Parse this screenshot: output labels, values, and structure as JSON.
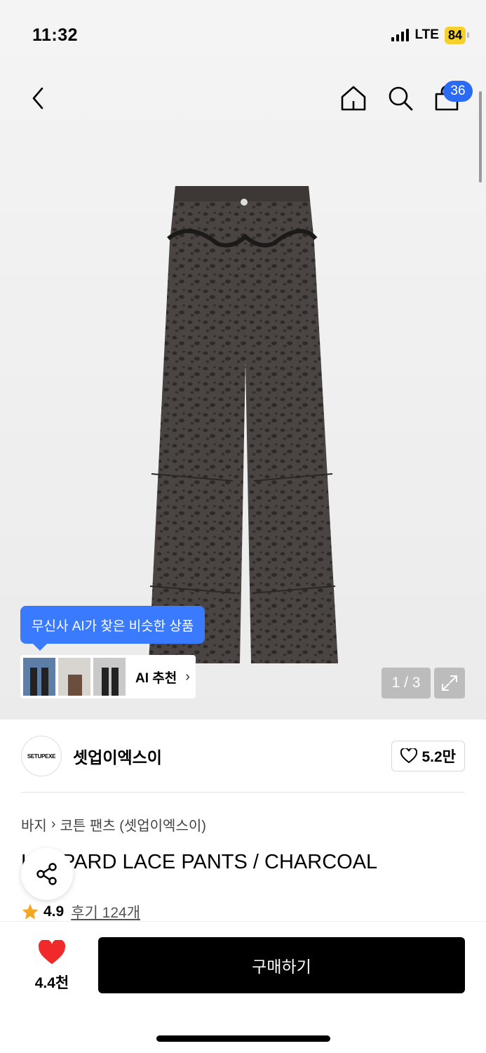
{
  "status_bar": {
    "time": "11:32",
    "network": "LTE",
    "battery": "84"
  },
  "nav": {
    "cart_count": "36"
  },
  "gallery": {
    "ai_tooltip": "무신사 AI가 찾은 비슷한 상품",
    "ai_recommend_label": "AI 추천",
    "pager": "1 / 3"
  },
  "brand": {
    "logo_text": "SETUPEXE",
    "name": "셋업이엑스이",
    "likes": "5.2만"
  },
  "product": {
    "breadcrumb": [
      "바지",
      "코튼 팬츠 (셋업이엑스이)"
    ],
    "title": "LEOPARD LACE PANTS / CHARCOAL",
    "rating": "4.9",
    "reviews": "후기 124개"
  },
  "bottom": {
    "wish_count": "4.4천",
    "buy_label": "구매하기"
  },
  "colors": {
    "accent": "#3a7afe",
    "badge": "#2a6af5",
    "heart": "#f02a2a",
    "star": "#f5a623"
  }
}
